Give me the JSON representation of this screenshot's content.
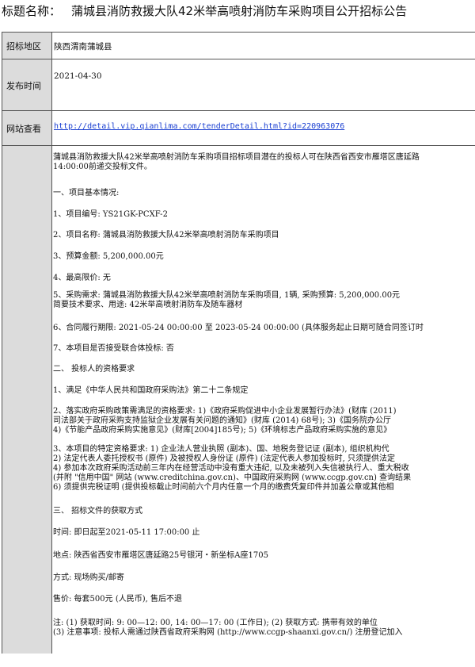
{
  "header": {
    "label": "标题名称：",
    "title": "蒲城县消防救援大队42米举高喷射消防车采购项目公开招标公告"
  },
  "info_table": {
    "region_label": "招标地区",
    "region_value": "陕西渭南蒲城县",
    "date_label": "发布时间",
    "date_value": "2021-04-30",
    "url_label": "网站查看",
    "url_value": "http://detail.vip.qianlima.com/tenderDetail.html?id=220963076"
  },
  "body": {
    "intro_1": "蒲城县消防救援大队42米举高喷射消防车采购项目招标项目潜在的投标人可在陕西省西安市雁塔区唐延路",
    "intro_2": "14:00:00前递交投标文件。",
    "s1_title": "一、项目基本情况:",
    "item1": "1、项目编号: YS21GK-PCXF-2",
    "item2": "2、项目名称: 蒲城县消防救援大队42米举高喷射消防车采购项目",
    "item3": "3、预算金额: 5,200,000.00元",
    "item4": "4、最高限价:  无",
    "item5_1": "5、采购需求:  蒲城县消防救援大队42米举高喷射消防车采购项目, 1辆,  采购预算:  5,200,000.00元",
    "item5_2": "简要技术要求、用途:  42米举高喷射消防车及随车器材",
    "item6": "6、合同履行期限: 2021-05-24 00:00:00 至 2023-05-24 00:00:00 (具体服务起止日期可随合同签订时",
    "item7": "7、本项目是否接受联合体投标: 否",
    "s2_title": "二、  投标人的资格要求",
    "q1": "1、满足《中华人民共和国政府采购法》第二十二条规定",
    "q2_1": "2、落实政府采购政策需满足的资格要求: 1)《政府采购促进中小企业发展暂行办法》(财库 (2011)",
    "q2_2": "司法部关于政府采购支持监狱企业发展有关问题的通知》(财库 (2014) 68号);  3)《国务院办公厅",
    "q2_3": "4)《节能产品政府采购实施意见》(财库[2004]185号);  5)《环境标志产品政府采购实施的意见》",
    "q3_1": "3、本项目的特定资格要求: 1) 企业法人营业执照 (副本)、国、地税务登记证 (副本), 组织机构代",
    "q3_2": "2) 法定代表人委托授权书 (原件) 及被授权人身份证 (原件) (法定代表人参加投标时, 只须提供法定",
    "q3_3": "4) 参加本次政府采购活动前三年内在经营活动中没有重大违纪, 以及未被列入失信被执行人、重大税收",
    "q3_4": "(并附 \"信用中国\" 网站 (www.creditchina.gov.cn)、中国政府采购网 (www.ccgp.gov.cn) 查询结果",
    "q3_5": "6) 须提供完税证明 (提供投标截止时间前六个月内任意一个月的缴费凭复印件并加盖公章或其他相",
    "s3_title": "三、  招标文件的获取方式",
    "time": "时间: 即日起至2021-05-11 17:00:00 止",
    "place": "地点: 陕西省西安市雁塔区唐延路25号银河・新坐标A座1705",
    "method": "方式: 现场购买/邮寄",
    "price": "售价:  每套500元 (人民币), 售后不退",
    "note_1": "注:  (1) 获取时间: 9: 00—12: 00, 14: 00—17: 00 (工作日);   (2) 获取方式: 携带有效的单位",
    "note_2": "(3) 注意事项: 投标人需通过陕西省政府采购网 (http://www.ccgp-shaanxi.gov.cn/) 注册登记加入"
  }
}
